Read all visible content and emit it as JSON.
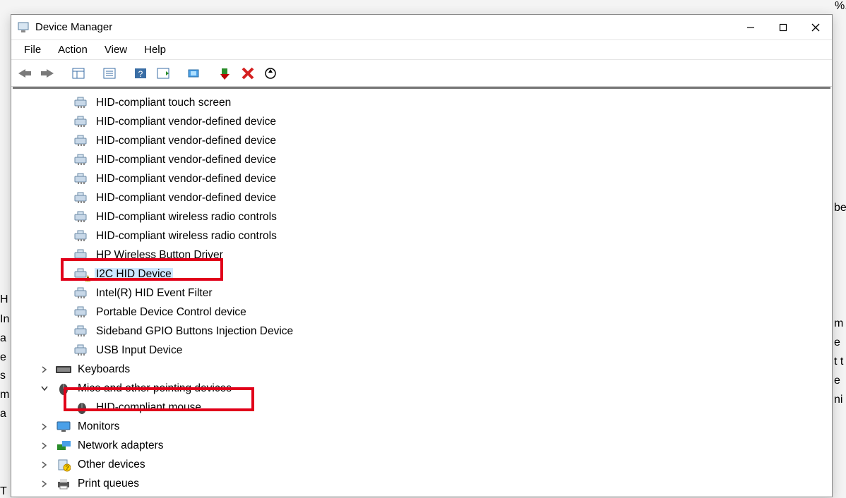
{
  "window": {
    "title": "Device Manager"
  },
  "menu": {
    "file": "File",
    "action": "Action",
    "view": "View",
    "help": "Help"
  },
  "tree": {
    "hid_children": [
      "HID-compliant touch screen",
      "HID-compliant vendor-defined device",
      "HID-compliant vendor-defined device",
      "HID-compliant vendor-defined device",
      "HID-compliant vendor-defined device",
      "HID-compliant vendor-defined device",
      "HID-compliant wireless radio controls",
      "HID-compliant wireless radio controls",
      "HP Wireless Button Driver"
    ],
    "i2c_device": "I2C HID Device",
    "hid_tail": [
      "Intel(R) HID Event Filter",
      "Portable Device Control device",
      "Sideband GPIO Buttons Injection Device",
      "USB Input Device"
    ],
    "keyboards": "Keyboards",
    "mice_category": "Mice and other pointing devices",
    "mouse_child": "HID-compliant mouse",
    "monitors": "Monitors",
    "network": "Network adapters",
    "other": "Other devices",
    "print": "Print queues"
  },
  "bg_text": {
    "pct": "%.",
    "be": "be",
    "H": "H",
    "In": "In",
    "a1": "a",
    "e1": "e",
    "s": "s",
    "m1": "m",
    "a2": "a",
    "T": "T",
    "m2": "m",
    "e2": "e",
    "tt": "t t",
    "e3": "e",
    "ni": "ni"
  }
}
